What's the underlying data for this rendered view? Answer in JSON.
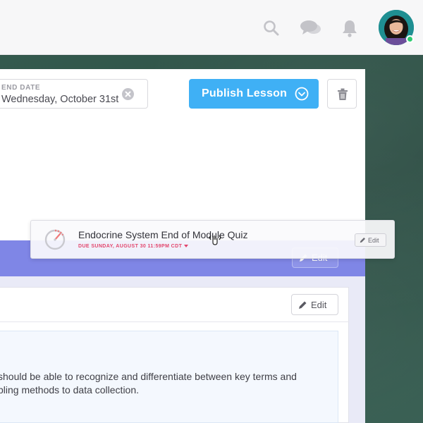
{
  "header": {
    "icons": [
      "search-icon",
      "chat-icon",
      "bell-icon"
    ],
    "avatar_status": "online"
  },
  "lesson": {
    "end_date_label": "END DATE",
    "end_date_value": "Wednesday, October 31st",
    "publish_label": "Publish Lesson",
    "section_edit_label": "Edit",
    "card_edit_label": "Edit",
    "description_lines": [
      "should be able to recognize and differentiate between key terms and",
      "pling methods to data collection."
    ]
  },
  "dragged_item": {
    "title": "Endocrine System End of Module Quiz",
    "due": "DUE SUNDAY, AUGUST 30 11:59PM CDT",
    "edit_label": "Edit"
  },
  "colors": {
    "publish": "#3fb0f5",
    "section_bar": "#7f86e6",
    "due_text": "#e2456c",
    "online": "#2ecc71",
    "board": "#2f5247"
  }
}
